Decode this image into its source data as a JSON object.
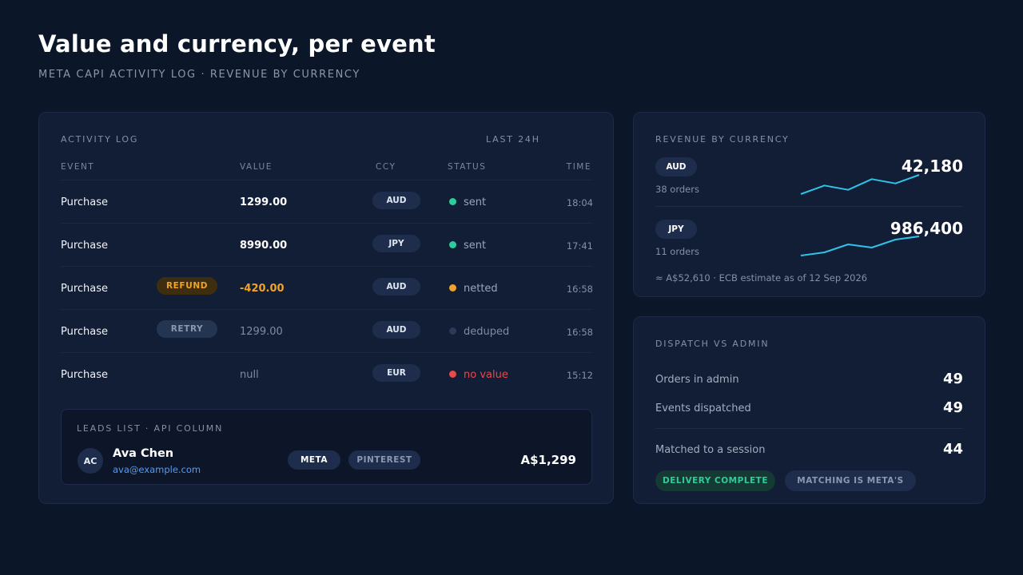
{
  "header": {
    "title": "Value and currency, per event",
    "subtitle": "META CAPI ACTIVITY LOG · REVENUE BY CURRENCY"
  },
  "activity_log": {
    "label": "ACTIVITY LOG",
    "range": "LAST 24H",
    "columns": [
      "EVENT",
      "VALUE",
      "CCY",
      "STATUS",
      "TIME"
    ],
    "rows": [
      {
        "event": "Purchase",
        "tag": "",
        "value": "1299.00",
        "ccy": "AUD",
        "status": "sent",
        "time": "18:04"
      },
      {
        "event": "Purchase",
        "tag": "",
        "value": "8990.00",
        "ccy": "JPY",
        "status": "sent",
        "time": "17:41"
      },
      {
        "event": "Purchase",
        "tag": "REFUND",
        "value": "-420.00",
        "ccy": "AUD",
        "status": "netted",
        "time": "16:58"
      },
      {
        "event": "Purchase",
        "tag": "RETRY",
        "value": "1299.00",
        "ccy": "AUD",
        "status": "deduped",
        "time": "16:58"
      },
      {
        "event": "Purchase",
        "tag": "",
        "value": "null",
        "ccy": "EUR",
        "status": "no value",
        "time": "15:12"
      }
    ],
    "status_colors": {
      "sent": "#2ecc9a",
      "netted": "#f0a32b",
      "deduped": "#2a3a58",
      "no value": "#e84a4a"
    }
  },
  "leads": {
    "label": "LEADS LIST · API COLUMN",
    "initials": "AC",
    "name": "Ava Chen",
    "email": "ava@example.com",
    "platforms": [
      "META",
      "PINTEREST"
    ],
    "amount": "A$1,299"
  },
  "revenue": {
    "label": "REVENUE BY CURRENCY",
    "currencies": [
      {
        "code": "AUD",
        "orders": "38 orders",
        "total": "42,180",
        "trend": [
          10,
          14,
          12,
          17,
          15,
          19
        ]
      },
      {
        "code": "JPY",
        "orders": "11 orders",
        "total": "986,400",
        "trend": [
          8,
          10,
          15,
          13,
          18,
          20
        ]
      }
    ],
    "note": "≈ A$52,610 · ECB estimate as of 12 Sep 2026",
    "accent": "#2fc3e8"
  },
  "dispatch": {
    "label": "DISPATCH VS ADMIN",
    "stats": [
      {
        "label": "Orders in admin",
        "value": "49"
      },
      {
        "label": "Events dispatched",
        "value": "49"
      },
      {
        "label": "Matched to a session",
        "value": "44"
      }
    ],
    "pills": [
      "DELIVERY COMPLETE",
      "MATCHING IS META'S"
    ]
  }
}
